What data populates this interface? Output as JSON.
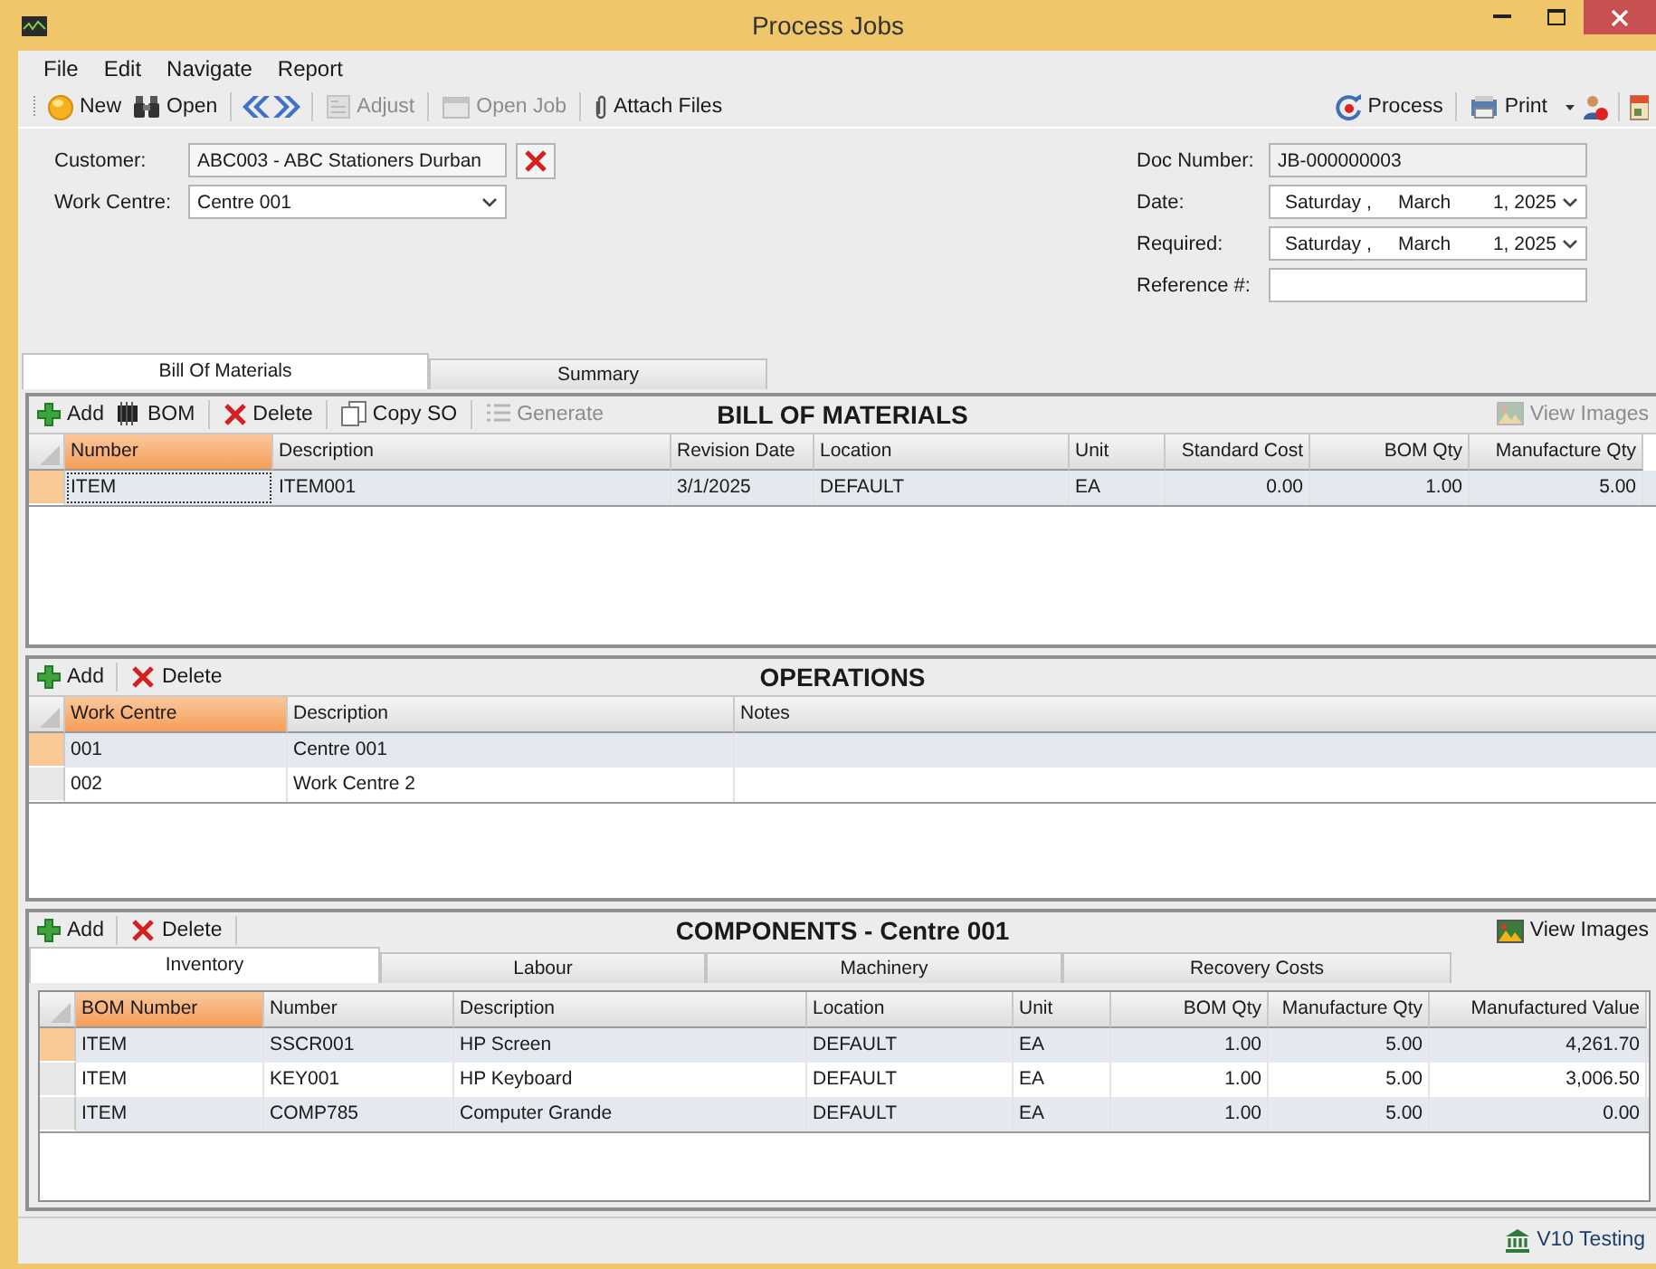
{
  "window": {
    "title": "Process Jobs"
  },
  "menu": [
    "File",
    "Edit",
    "Navigate",
    "Report"
  ],
  "toolbar": {
    "left": [
      {
        "kind": "button",
        "label": "New",
        "disabled": false
      },
      {
        "kind": "button",
        "label": "Open",
        "disabled": false
      },
      {
        "kind": "separator"
      },
      {
        "kind": "icon_button"
      },
      {
        "kind": "icon_button"
      },
      {
        "kind": "separator"
      },
      {
        "kind": "button",
        "label": "Adjust",
        "disabled": true
      },
      {
        "kind": "separator"
      },
      {
        "kind": "button",
        "label": "Open Job",
        "disabled": true
      },
      {
        "kind": "separator"
      },
      {
        "kind": "button",
        "label": "Attach Files",
        "disabled": false
      }
    ],
    "right": [
      {
        "kind": "button",
        "label": "Process",
        "disabled": false
      },
      {
        "kind": "separator"
      },
      {
        "kind": "split_button",
        "label": "Print",
        "disabled": false
      },
      {
        "kind": "icon_button"
      },
      {
        "kind": "separator"
      },
      {
        "kind": "icon_button"
      }
    ]
  },
  "form": {
    "left": [
      {
        "label": "Customer:",
        "kind": "lookup",
        "value": "ABC003 - ABC Stationers Durban"
      },
      {
        "label": "Work Centre:",
        "kind": "dropdown",
        "value": "Centre 001"
      }
    ],
    "right": [
      {
        "label": "Doc Number:",
        "kind": "readonly",
        "value": "JB-000000003"
      },
      {
        "label": "Date:",
        "kind": "date",
        "value": "Saturday ,     March        1, 2025"
      },
      {
        "label": "Required:",
        "kind": "date",
        "value": "Saturday ,     March        1, 2025"
      },
      {
        "label": "Reference #:",
        "kind": "text"
      }
    ]
  },
  "tabs": [
    {
      "label": "Bill Of Materials",
      "selected": true
    },
    {
      "label": "Summary",
      "selected": false
    }
  ],
  "bill_of_materials": {
    "title": "BILL OF MATERIALS",
    "toolbar": [
      {
        "kind": "button",
        "label": "Add",
        "disabled": false
      },
      {
        "kind": "button",
        "label": "BOM",
        "disabled": false
      },
      {
        "kind": "separator"
      },
      {
        "kind": "button",
        "label": "Delete",
        "disabled": false
      },
      {
        "kind": "separator"
      },
      {
        "kind": "button",
        "label": "Copy SO",
        "disabled": false
      },
      {
        "kind": "separator"
      },
      {
        "kind": "button",
        "label": "Generate",
        "disabled": true
      }
    ],
    "view_images": {
      "label": "View Images",
      "disabled": true
    },
    "columns": [
      "Number",
      "Description",
      "Revision Date",
      "Location",
      "Unit",
      "Standard Cost",
      "BOM Qty",
      "Manufacture Qty"
    ],
    "rows": [
      {
        "selected": true,
        "cells": [
          "ITEM",
          "ITEM001",
          "3/1/2025",
          "DEFAULT",
          "EA",
          "0.00",
          "1.00",
          "5.00"
        ]
      }
    ]
  },
  "operations": {
    "title": "OPERATIONS",
    "toolbar": [
      {
        "kind": "button",
        "label": "Add",
        "disabled": false
      },
      {
        "kind": "separator"
      },
      {
        "kind": "button",
        "label": "Delete",
        "disabled": false
      }
    ],
    "columns": [
      "Work Centre",
      "Description",
      "Notes"
    ],
    "rows": [
      {
        "selected": true,
        "cells": [
          "001",
          "Centre 001",
          ""
        ]
      },
      {
        "selected": false,
        "cells": [
          "002",
          "Work Centre 2",
          ""
        ]
      }
    ]
  },
  "components": {
    "title": "COMPONENTS - Centre 001",
    "toolbar": [
      {
        "kind": "button",
        "label": "Add",
        "disabled": false
      },
      {
        "kind": "separator"
      },
      {
        "kind": "button",
        "label": "Delete",
        "disabled": false
      },
      {
        "kind": "separator"
      }
    ],
    "view_images": {
      "label": "View Images",
      "disabled": false
    },
    "tabs": [
      {
        "label": "Inventory",
        "selected": true
      },
      {
        "label": "Labour",
        "selected": false
      },
      {
        "label": "Machinery",
        "selected": false
      },
      {
        "label": "Recovery Costs",
        "selected": false
      }
    ],
    "columns": [
      "BOM Number",
      "Number",
      "Description",
      "Location",
      "Unit",
      "BOM Qty",
      "Manufacture Qty",
      "Manufactured Value"
    ],
    "rows": [
      {
        "selected": true,
        "cells": [
          "ITEM",
          "SSCR001",
          "HP Screen",
          "DEFAULT",
          "EA",
          "1.00",
          "5.00",
          "4,261.70"
        ]
      },
      {
        "selected": false,
        "cells": [
          "ITEM",
          "KEY001",
          "HP Keyboard",
          "DEFAULT",
          "EA",
          "1.00",
          "5.00",
          "3,006.50"
        ]
      },
      {
        "selected": false,
        "cells": [
          "ITEM",
          "COMP785",
          "Computer Grande",
          "DEFAULT",
          "EA",
          "1.00",
          "5.00",
          "0.00"
        ]
      }
    ]
  },
  "status_bar": {
    "label": "V10 Testing"
  }
}
